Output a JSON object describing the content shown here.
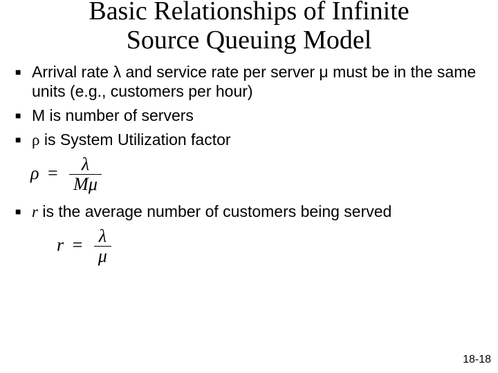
{
  "title_line1": "Basic Relationships of Infinite",
  "title_line2": "Source Queuing Model",
  "bullets": {
    "b1": "Arrival rate λ and service rate per server μ must be in the same units (e.g., customers per hour)",
    "b2": "M is number of servers",
    "b3_prefix": "ρ",
    "b3_rest": " is System Utilization factor",
    "b4_prefix": "r",
    "b4_rest": " is the average number of customers being served"
  },
  "formulas": {
    "rho_lhs": "ρ",
    "rho_num": "λ",
    "rho_den": "Mμ",
    "r_lhs": "r",
    "r_num": "λ",
    "r_den": "μ"
  },
  "page_number": "18-18"
}
